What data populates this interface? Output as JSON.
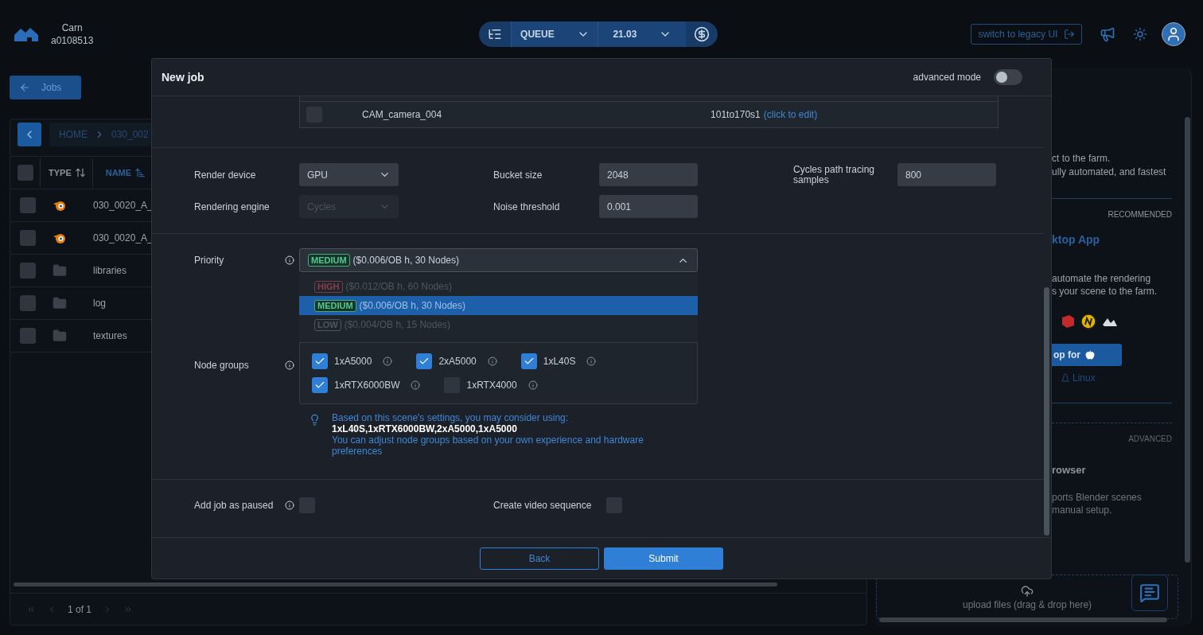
{
  "header": {
    "user_name": "Carn",
    "user_id": "a0108513",
    "queue_label": "QUEUE",
    "version": "21.03",
    "legacy_button": "switch to legacy UI"
  },
  "jobs_button": "Jobs",
  "file_browser": {
    "breadcrumb": [
      "HOME",
      "030_002"
    ],
    "select_all_checked": false,
    "columns": [
      {
        "label": "TYPE",
        "sorted": false
      },
      {
        "label": "NAME",
        "sorted": true
      }
    ],
    "rows": [
      {
        "kind": "blend",
        "name": "030_0020_A_",
        "checked": false
      },
      {
        "kind": "blend",
        "name": "030_0020_A_",
        "checked": false
      },
      {
        "kind": "folder",
        "name": "libraries",
        "checked": false
      },
      {
        "kind": "folder",
        "name": "log",
        "checked": false
      },
      {
        "kind": "folder",
        "name": "textures",
        "checked": false
      }
    ],
    "pagination": "1 of 1"
  },
  "right_panel": {
    "intro_lines": [
      "ct to the farm.",
      "ully automated, and fastest"
    ],
    "recommended_tag": "RECOMMENDED",
    "app_title": "ktop App",
    "app_lines": [
      "automate the rendering",
      "s your scene to the farm."
    ],
    "download_button": "op for",
    "linux_link": "Linux",
    "advanced_tag": "ADVANCED",
    "browser_title": "rowser",
    "browser_lines": [
      "ports Blender scenes",
      "manual setup."
    ],
    "upload_hint": "upload files (drag & drop here)"
  },
  "modal": {
    "title": "New job",
    "advanced_mode": {
      "label": "advanced mode",
      "on": false
    },
    "camera_row": {
      "checked": false,
      "name": "CAM_camera_004",
      "frames": "101to170s1",
      "edit_link": "(click to edit)"
    },
    "render_device": {
      "label": "Render device",
      "value": "GPU"
    },
    "rendering_engine": {
      "label": "Rendering engine",
      "value": "Cycles",
      "disabled": true
    },
    "bucket_size": {
      "label": "Bucket size",
      "value": "2048"
    },
    "noise_threshold": {
      "label": "Noise threshold",
      "value": "0.001"
    },
    "samples": {
      "label": "Cycles path tracing samples",
      "value": "800"
    },
    "priority": {
      "label": "Priority",
      "current": {
        "kind": "medium",
        "badge": "MEDIUM",
        "text": "($0.006/OB h, 30 Nodes)"
      },
      "options": [
        {
          "badge": "HIGH",
          "kind": "high",
          "text": "($0.012/OB h, 60 Nodes)",
          "selected": false
        },
        {
          "badge": "MEDIUM",
          "kind": "medium",
          "text": "($0.006/OB h, 30 Nodes)",
          "selected": true
        },
        {
          "badge": "LOW",
          "kind": "low",
          "text": "($0.004/OB h, 15 Nodes)",
          "selected": false
        }
      ]
    },
    "node_groups": {
      "label": "Node groups",
      "groups": [
        [
          {
            "name": "1xA5000",
            "checked": true
          },
          {
            "name": "2xA5000",
            "checked": true
          },
          {
            "name": "1xL40S",
            "checked": true
          }
        ],
        [
          {
            "name": "1xRTX6000BW",
            "checked": true
          },
          {
            "name": "1xRTX4000",
            "checked": false
          }
        ]
      ]
    },
    "hint": {
      "intro": "Based on this scene's settings, you may consider using:",
      "suggestion": "1xL40S,1xRTX6000BW,2xA5000,1xA5000",
      "note": "You can adjust node groups based on your own experience and hardware preferences"
    },
    "add_paused": {
      "label": "Add job as paused",
      "checked": false
    },
    "video_sequence": {
      "label": "Create video sequence",
      "checked": false
    },
    "buttons": {
      "back": "Back",
      "submit": "Submit"
    }
  }
}
